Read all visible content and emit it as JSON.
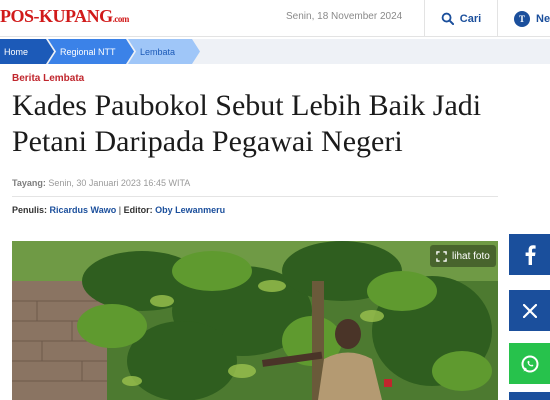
{
  "header": {
    "logo_text": "POS-KUPANG",
    "logo_suffix": ".com",
    "date": "Senin, 18 November 2024",
    "search_label": "Cari",
    "search_icon": "search-icon",
    "network_label": "Net",
    "network_badge": "T"
  },
  "breadcrumb": [
    {
      "label": "Home"
    },
    {
      "label": "Regional NTT"
    },
    {
      "label": "Lembata"
    }
  ],
  "article": {
    "category": "Berita Lembata",
    "title_line1": "Kades Paubokol Sebut Lebih Baik Jadi",
    "title_line2": "Petani Daripada Pegawai Negeri",
    "published_label": "Tayang:",
    "published_date": "Senin, 30 Januari 2023 16:45 WITA",
    "writer_label": "Penulis:",
    "writer": "Ricardus Wawo",
    "editor_label": "Editor:",
    "editor": "Oby Lewanmeru",
    "photo_button": "lihat foto"
  },
  "share": {
    "facebook_icon": "facebook-icon",
    "x_icon": "x-icon",
    "whatsapp_icon": "whatsapp-icon"
  },
  "colors": {
    "brand_red": "#d11a1a",
    "brand_blue": "#1b4f9c",
    "facebook": "#1a4f9c",
    "whatsapp": "#27c24c"
  }
}
